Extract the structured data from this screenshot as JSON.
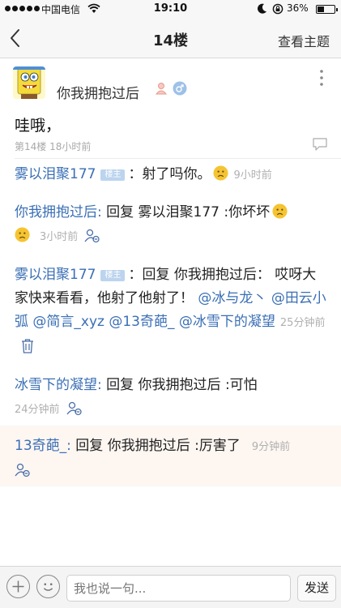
{
  "status_bar": {
    "carrier": "中国电信",
    "time": "19:10",
    "battery": "36%",
    "battery_level": 0.36
  },
  "nav": {
    "title": "14楼",
    "view_topic": "查看主题"
  },
  "post": {
    "author": "你我拥抱过后",
    "body": "哇哦，",
    "meta": "第14楼 18小时前"
  },
  "replies": [
    {
      "name": "雾以泪聚177",
      "badge": "楼主",
      "text": "：射了吗你。",
      "time": "9小时前"
    },
    {
      "name": "你我拥抱过后:",
      "text": " 回复 雾以泪聚177 :你坏坏",
      "time": "3小时前"
    },
    {
      "name": "雾以泪聚177",
      "badge": "楼主",
      "text": "：回复 你我拥抱过后： 哎呀大家快来看看，他射了他射了！",
      "mentions": [
        "@冰与龙丶",
        "@田云小弧",
        "@简言_xyz",
        "@13奇葩_",
        "@冰雪下的凝望"
      ],
      "time": "25分钟前"
    },
    {
      "name": "冰雪下的凝望:",
      "text": " 回复 你我拥抱过后 :可怕",
      "time": "24分钟前"
    },
    {
      "name": "13奇葩_:",
      "text": " 回复 你我拥抱过后 :厉害了",
      "time": "9分钟前"
    }
  ],
  "input": {
    "placeholder": "我也说一句...",
    "send_label": "发送"
  }
}
